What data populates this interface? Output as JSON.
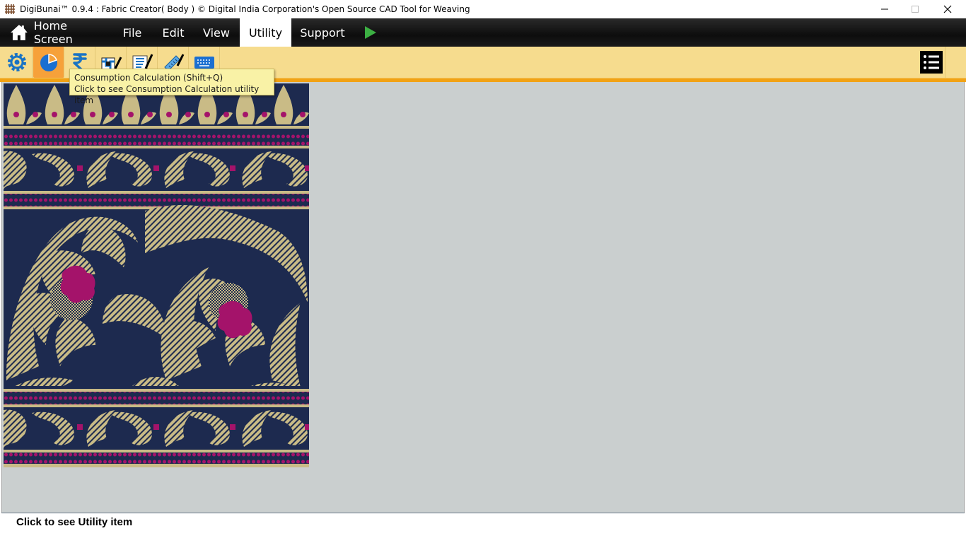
{
  "window": {
    "title": "DigiBunai™ 0.9.4 : Fabric Creator( Body ) © Digital India Corporation's Open Source CAD Tool for Weaving"
  },
  "menu": {
    "home": "Home Screen",
    "file": "File",
    "edit": "Edit",
    "view": "View",
    "utility": "Utility",
    "support": "Support",
    "active": "Utility"
  },
  "toolbar": {
    "icons": [
      "settings-icon",
      "consumption-calculation-icon",
      "rupee-icon",
      "weave-edit-icon",
      "draft-edit-icon",
      "ruler-pencil-icon",
      "keyboard-icon",
      "list-menu-icon"
    ]
  },
  "tooltip": {
    "title": "Consumption Calculation (Shift+Q)",
    "description": "Click to see Consumption Calculation utility item"
  },
  "status": {
    "message": "Click to see Utility item"
  },
  "colors": {
    "navy": "#1d2a4f",
    "gold": "#c9bb86",
    "magenta": "#a4136a",
    "toolbar": "#f6dc8e",
    "workspace": "#cacfcf"
  }
}
